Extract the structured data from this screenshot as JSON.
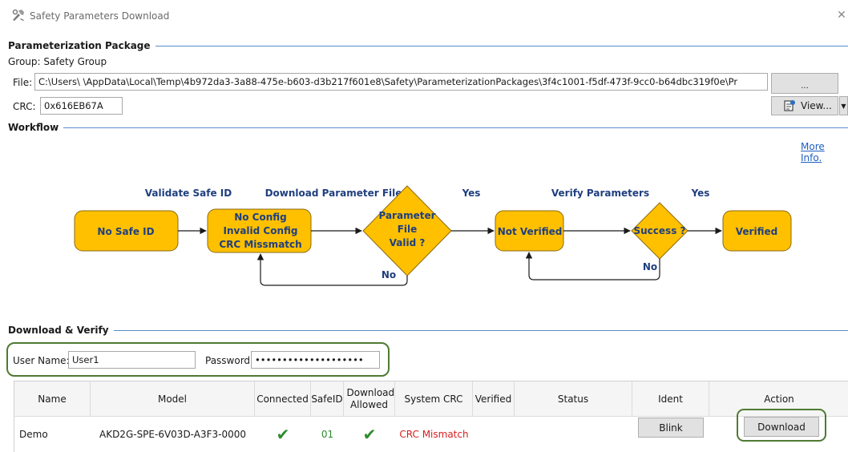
{
  "window": {
    "title": "Safety Parameters Download"
  },
  "package": {
    "section_title": "Parameterization Package",
    "group_label": "Group: Safety Group",
    "file_label": "File:",
    "file_path": "C:\\Users\\          \\AppData\\Local\\Temp\\4b972da3-3a88-475e-b603-d3b217f601e8\\Safety\\ParameterizationPackages\\3f4c1001-f5df-473f-9cc0-b64dbc319f0e\\Pr",
    "browse_label": "...",
    "crc_label": "CRC:",
    "crc_value": "0x616EB67A",
    "view_label": "View..."
  },
  "workflow": {
    "section_title": "Workflow",
    "more_info": "More Info.",
    "step_labels": {
      "validate": "Validate Safe ID",
      "download": "Download Parameter File",
      "verify": "Verify Parameters",
      "yes1": "Yes",
      "yes2": "Yes",
      "no1": "No",
      "no2": "No"
    },
    "nodes": {
      "no_safe_id": "No Safe ID",
      "no_config_1": "No Config",
      "no_config_2": "Invalid Config",
      "no_config_3": "CRC Missmatch",
      "param_1": "Parameter",
      "param_2": "File",
      "param_3": "Valid ?",
      "not_verified": "Not Verified",
      "success": "Success ?",
      "verified": "Verified"
    },
    "colors": {
      "node_fill": "#FFC000",
      "node_stroke": "#8a6a10",
      "text": "#1f3f7f"
    }
  },
  "download": {
    "section_title": "Download & Verify",
    "user_label": "User Name:",
    "user_value": "User1",
    "password_label": "Password:",
    "password_value": "••••••••••••••••••••",
    "columns": [
      "Name",
      "Model",
      "Connected",
      "SafeID",
      "Download Allowed",
      "System CRC",
      "Verified",
      "Status",
      "Ident",
      "Action"
    ],
    "row": {
      "name": "Demo",
      "model": "AKD2G-SPE-6V03D-A3F3-0000",
      "connected": "✔",
      "safeid": "01",
      "download_allowed": "✔",
      "system_crc": "CRC Mismatch",
      "verified": "",
      "status": "",
      "ident": "Blink",
      "action": "Download"
    },
    "colors": {
      "check": "#2e8b2e",
      "mismatch": "#d62020",
      "safeid": "#2e8b2e",
      "highlight": "#4f7a32"
    }
  }
}
